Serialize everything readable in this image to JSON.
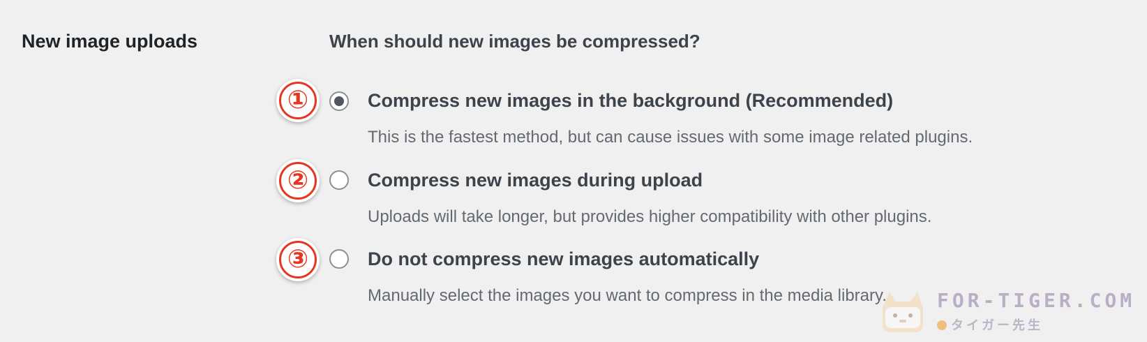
{
  "section": {
    "title": "New image uploads",
    "question": "When should new images be compressed?"
  },
  "options": [
    {
      "marker": "①",
      "label": "Compress new images in the background (Recommended)",
      "description": "This is the fastest method, but can cause issues with some image related plugins.",
      "checked": true
    },
    {
      "marker": "②",
      "label": "Compress new images during upload",
      "description": "Uploads will take longer, but provides higher compatibility with other plugins.",
      "checked": false
    },
    {
      "marker": "③",
      "label": "Do not compress new images automatically",
      "description": "Manually select the images you want to compress in the media library.",
      "checked": false
    }
  ],
  "watermark": {
    "text": "FOR-TIGER.COM",
    "subtext": "タイガー先生"
  },
  "colors": {
    "background": "#f0f0f1",
    "marker": "#e8351f",
    "radio_dot": "#50575e"
  }
}
